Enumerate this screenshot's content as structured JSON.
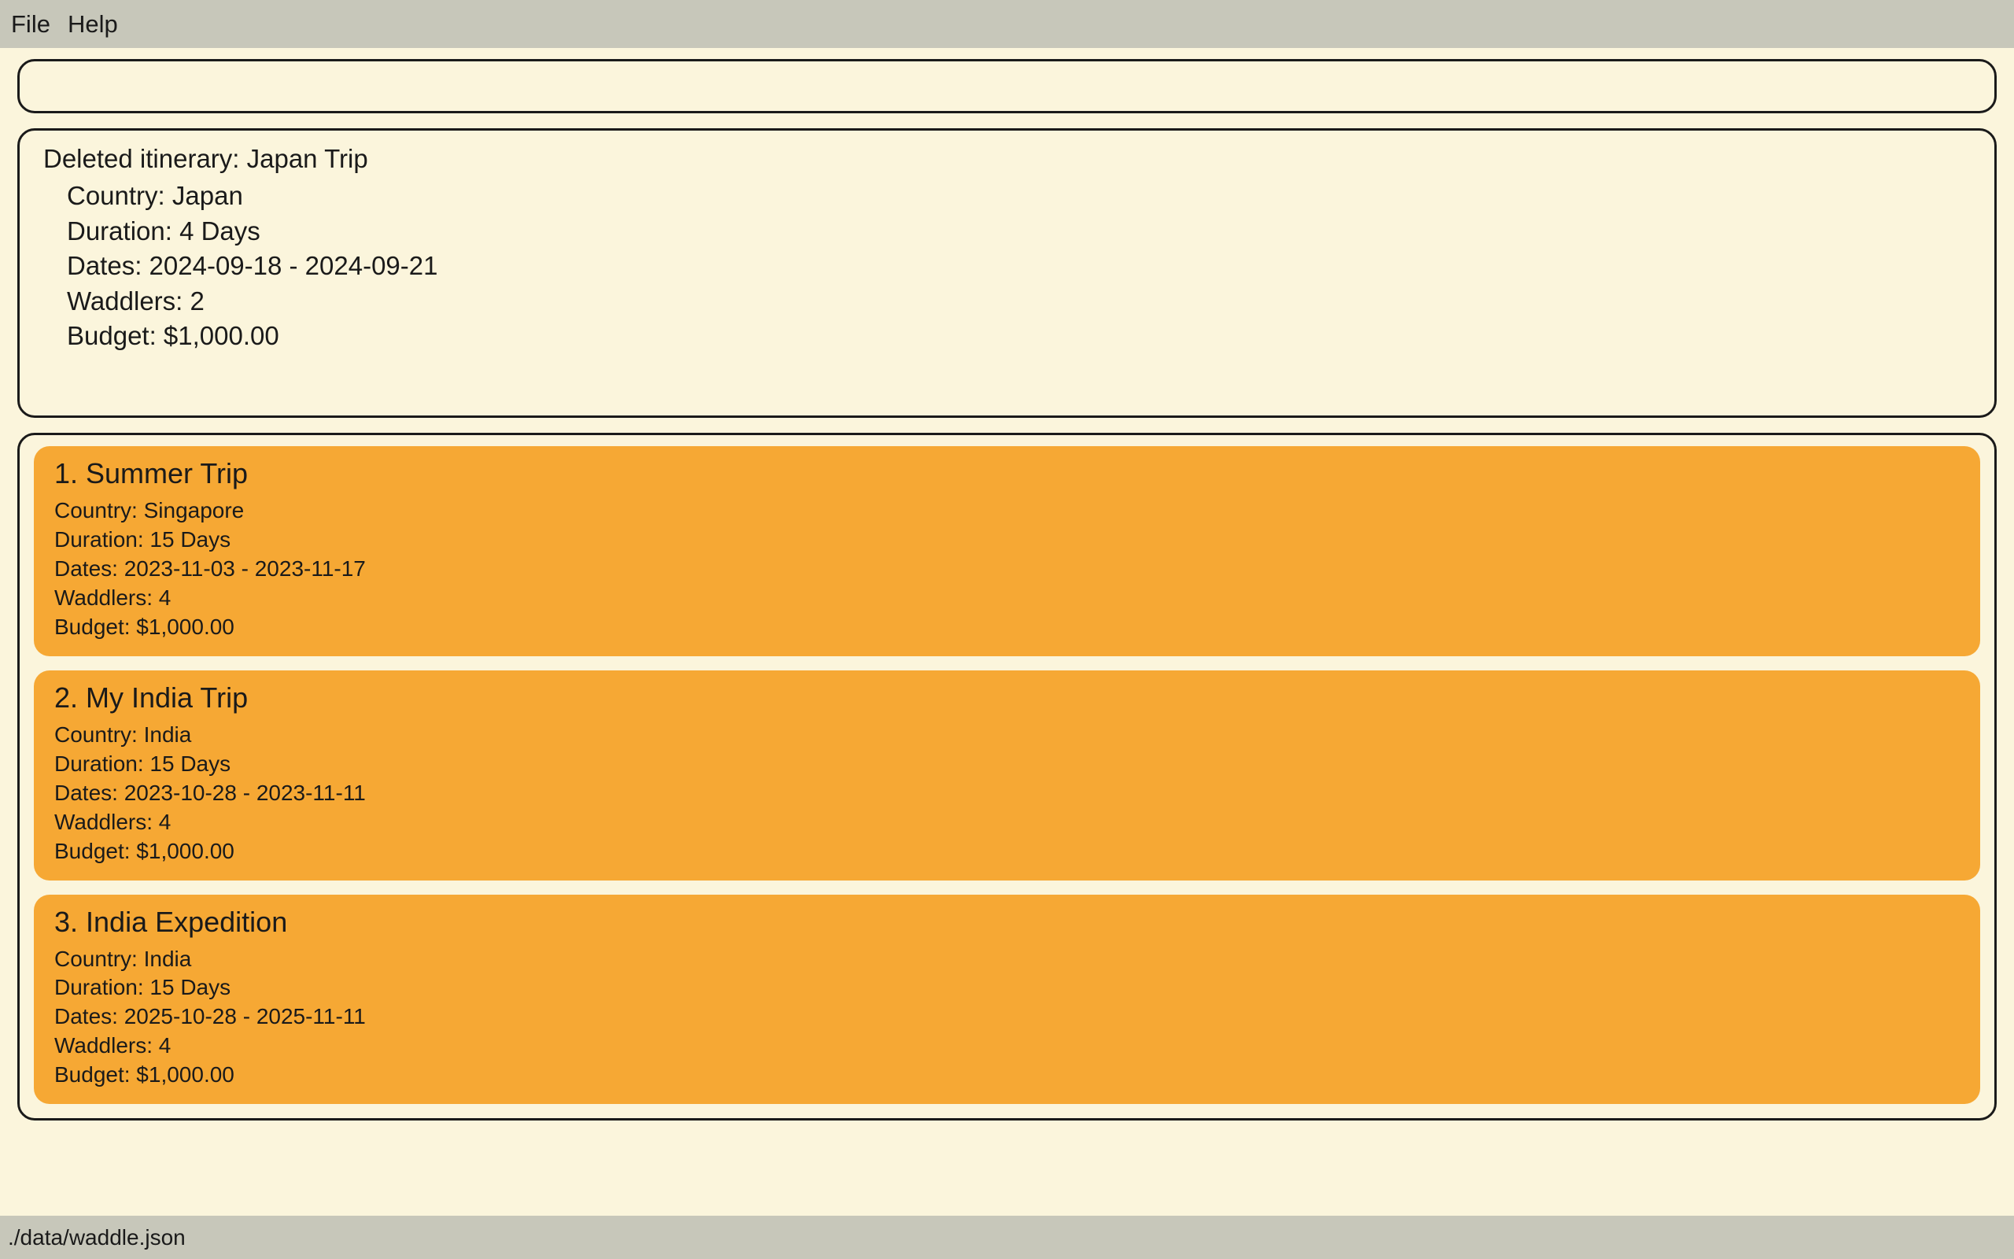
{
  "menubar": {
    "file": "File",
    "help": "Help"
  },
  "deleted_message": {
    "title": "Deleted itinerary: Japan Trip",
    "country": "Country: Japan",
    "duration": "Duration: 4 Days",
    "dates": "Dates: 2024-09-18 - 2024-09-21",
    "waddlers": "Waddlers: 2",
    "budget": "Budget: $1,000.00"
  },
  "itineraries": [
    {
      "title": "1.   Summer Trip",
      "country": "Country: Singapore",
      "duration": "Duration: 15 Days",
      "dates": "Dates: 2023-11-03 - 2023-11-17",
      "waddlers": "Waddlers: 4",
      "budget": "Budget: $1,000.00"
    },
    {
      "title": "2.   My India Trip",
      "country": "Country: India",
      "duration": "Duration: 15 Days",
      "dates": "Dates: 2023-10-28 - 2023-11-11",
      "waddlers": "Waddlers: 4",
      "budget": "Budget: $1,000.00"
    },
    {
      "title": "3.   India Expedition",
      "country": "Country: India",
      "duration": "Duration: 15 Days",
      "dates": "Dates: 2025-10-28 - 2025-11-11",
      "waddlers": "Waddlers: 4",
      "budget": "Budget: $1,000.00"
    }
  ],
  "statusbar": {
    "path": "./data/waddle.json"
  }
}
